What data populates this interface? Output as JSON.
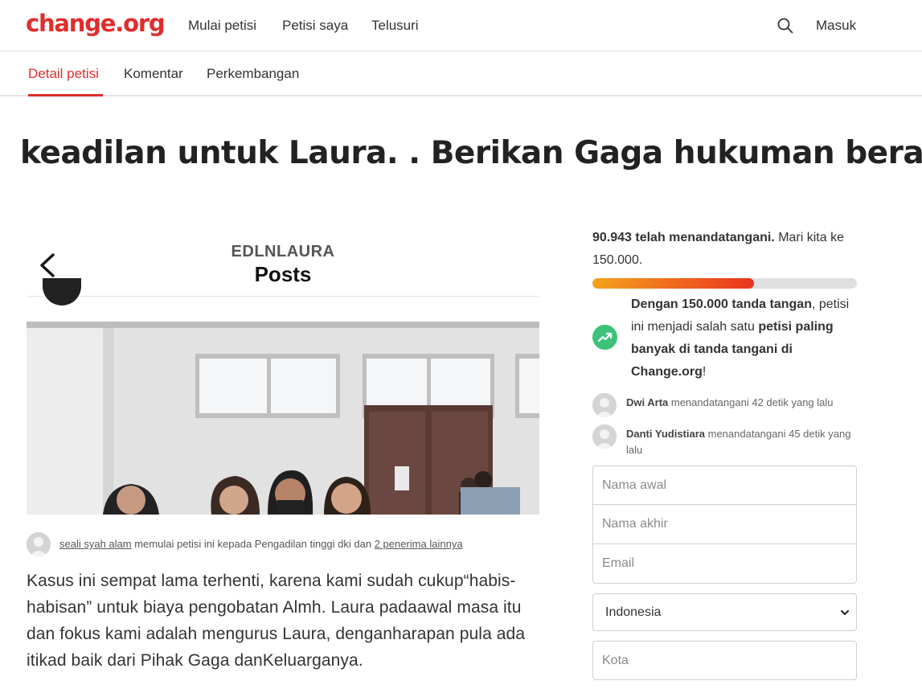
{
  "nav": {
    "logo": "change.org",
    "links": [
      "Mulai petisi",
      "Petisi saya",
      "Telusuri"
    ],
    "login": "Masuk"
  },
  "tabs": [
    "Detail petisi",
    "Komentar",
    "Perkembangan"
  ],
  "petition": {
    "title": "keadilan untuk Laura. . Berikan Gaga hukuman berat.",
    "media": {
      "username": "EDLNLAURA",
      "section": "Posts"
    },
    "starter": {
      "name": "seali syah alam",
      "middle": " memulai petisi ini kepada Pengadilan tinggi dki dan ",
      "others": "2 penerima lainnya"
    },
    "body": "Kasus ini sempat lama terhenti, karena kami sudah cukup“habis-habisan” untuk biaya pengobatan Almh. Laura padaawal masa itu dan fokus kami adalah mengurus Laura, denganharapan pula ada itikad baik dari Pihak Gaga danKeluarganya."
  },
  "sidebar": {
    "signed_count": "90.943 telah menandatangani.",
    "goal_text": " Mari kita ke 150.000.",
    "progress": 0.61,
    "milestone": {
      "part1": "Dengan 150.000 tanda tangan",
      "part2": ", petisi ini menjadi salah satu ",
      "part3": "petisi paling banyak di tanda tangani di Change.org",
      "part4": "!"
    },
    "recent_signers": [
      {
        "name": "Dwi Arta",
        "action": " menandatangani 42 detik yang lalu"
      },
      {
        "name": "Danti Yudistiara",
        "action": " menandatangani 45 detik yang lalu"
      }
    ],
    "form": {
      "first_name_placeholder": "Nama awal",
      "last_name_placeholder": "Nama akhir",
      "email_placeholder": "Email",
      "country": "Indonesia",
      "city_placeholder": "Kota"
    }
  },
  "icons": {
    "search": "search-icon",
    "back": "chevron-left-icon",
    "trend": "trending-up-icon",
    "chevron": "chevron-down-icon"
  },
  "colors": {
    "brand": "#e12d2d",
    "progress_start": "#f6a21e",
    "progress_end": "#e8341e",
    "trend": "#3ec27a"
  }
}
